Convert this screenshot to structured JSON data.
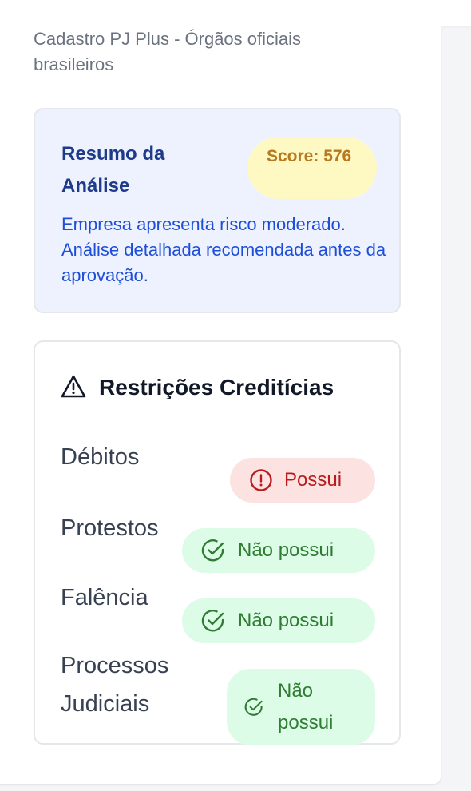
{
  "header": {
    "subtitle": "Cadastro PJ Plus - Órgãos oficiais brasileiros"
  },
  "summary": {
    "title": "Resumo da Análise",
    "score_label": "Score: 576",
    "description": "Empresa apresenta risco moderado. Análise detalhada recomendada antes da aprovação."
  },
  "restrictions": {
    "title": "Restrições Creditícias",
    "items": [
      {
        "label": "Débitos",
        "status": "Possui",
        "icon": "alert-circle-icon"
      },
      {
        "label": "Protestos",
        "status": "Não possui",
        "icon": "check-circle-icon"
      },
      {
        "label": "Falência",
        "status": "Não possui",
        "icon": "check-circle-icon"
      },
      {
        "label": "Processos Judiciais",
        "status": "Não possui",
        "icon": "check-circle-icon"
      }
    ]
  },
  "colors": {
    "negative": "#b91c1c",
    "positive": "#2f7d32",
    "score": "#b7791f",
    "summary_text": "#1d4ed8"
  }
}
